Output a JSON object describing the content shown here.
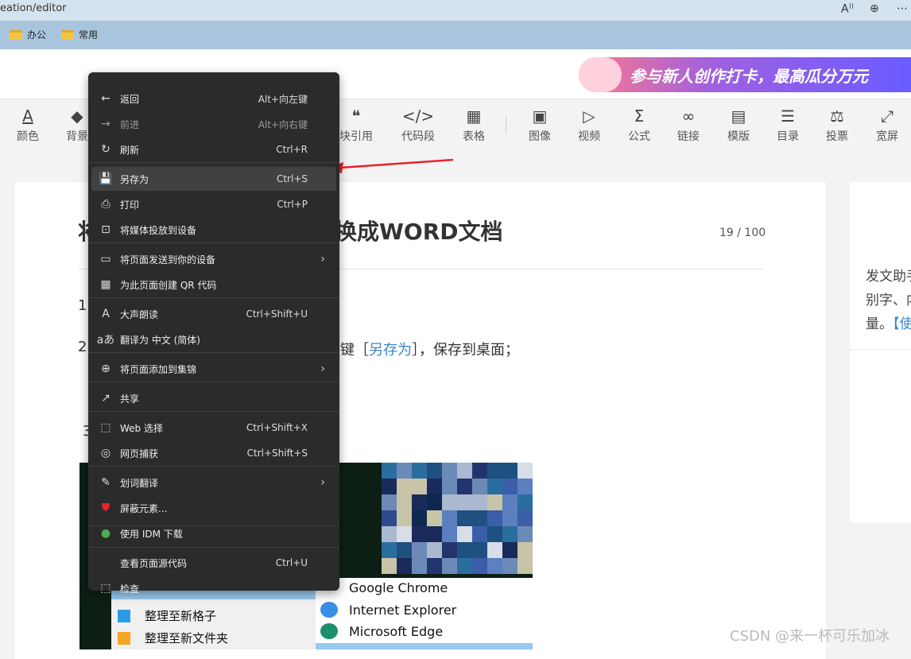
{
  "address_bar": {
    "url": "eation/editor"
  },
  "bookmarks": [
    {
      "label": "办公"
    },
    {
      "label": "常用"
    }
  ],
  "banner": {
    "text": "参与新人创作打卡，最高瓜分万元"
  },
  "toolbar": [
    {
      "label": "颜色",
      "icon": "A"
    },
    {
      "label": "背景",
      "icon": "◆"
    },
    {
      "label": "块引用",
      "icon": "❝"
    },
    {
      "label": "代码段",
      "icon": "</>"
    },
    {
      "label": "表格",
      "icon": "▦"
    },
    {
      "label": "图像",
      "icon": "▣"
    },
    {
      "label": "视频",
      "icon": "▷"
    },
    {
      "label": "公式",
      "icon": "Σ"
    },
    {
      "label": "链接",
      "icon": "∞"
    },
    {
      "label": "模版",
      "icon": "▤"
    },
    {
      "label": "目录",
      "icon": "☰"
    },
    {
      "label": "投票",
      "icon": "⚖"
    },
    {
      "label": "宽屏",
      "icon": "⤢"
    }
  ],
  "article": {
    "title_visible": "换成WORD文档",
    "title_left": "将",
    "counter": "19 / 100",
    "n1": "1",
    "n2": "2",
    "n3": "3",
    "para2_prefix": "键［",
    "para2_link": "另存为",
    "para2_suffix": "］，保存到桌面；"
  },
  "right_panel": {
    "line1": "发文助手",
    "line2": "别字、内",
    "line3": "量。",
    "line3_link": "【使"
  },
  "context_menu": {
    "items": [
      {
        "label": "返回",
        "shortcut": "Alt+向左键",
        "icon": "←"
      },
      {
        "label": "前进",
        "shortcut": "Alt+向右键",
        "icon": "→"
      },
      {
        "label": "刷新",
        "shortcut": "Ctrl+R",
        "icon": "↻"
      },
      {
        "label": "另存为",
        "shortcut": "Ctrl+S",
        "icon": "💾"
      },
      {
        "label": "打印",
        "shortcut": "Ctrl+P",
        "icon": "⎙"
      },
      {
        "label": "将媒体投放到设备",
        "shortcut": "",
        "icon": "⊡"
      },
      {
        "label": "将页面发送到你的设备",
        "shortcut": "",
        "icon": "▭"
      },
      {
        "label": "为此页面创建 QR 代码",
        "shortcut": "",
        "icon": "▦"
      },
      {
        "label": "大声朗读",
        "shortcut": "Ctrl+Shift+U",
        "icon": "A"
      },
      {
        "label": "翻译为 中文 (简体)",
        "shortcut": "",
        "icon": "aあ"
      },
      {
        "label": "将页面添加到集锦",
        "shortcut": "",
        "icon": "⊕"
      },
      {
        "label": "共享",
        "shortcut": "",
        "icon": "↗"
      },
      {
        "label": "Web 选择",
        "shortcut": "Ctrl+Shift+X",
        "icon": "⬚"
      },
      {
        "label": "网页捕获",
        "shortcut": "Ctrl+Shift+S",
        "icon": "◎"
      },
      {
        "label": "划词翻译",
        "shortcut": "",
        "icon": "✎"
      },
      {
        "label": "屏蔽元素...",
        "shortcut": "",
        "icon": "⛊"
      },
      {
        "label": "使用 IDM 下载",
        "shortcut": "",
        "icon": "●"
      },
      {
        "label": "查看页面源代码",
        "shortcut": "Ctrl+U",
        "icon": ""
      },
      {
        "label": "检查",
        "shortcut": "",
        "icon": "⬚"
      }
    ]
  },
  "screenshot_menu": {
    "left": [
      {
        "label": "整理至新格子"
      },
      {
        "label": "整理至新文件夹"
      }
    ],
    "right": [
      {
        "label": "Google Chrome"
      },
      {
        "label": "Internet Explorer"
      },
      {
        "label": "Microsoft Edge"
      }
    ]
  },
  "watermark": "CSDN @来一杯可乐加冰",
  "colors": {
    "accent": "#3b86c6",
    "menu_bg": "#2b2b2b",
    "arrow": "#e8232a"
  }
}
